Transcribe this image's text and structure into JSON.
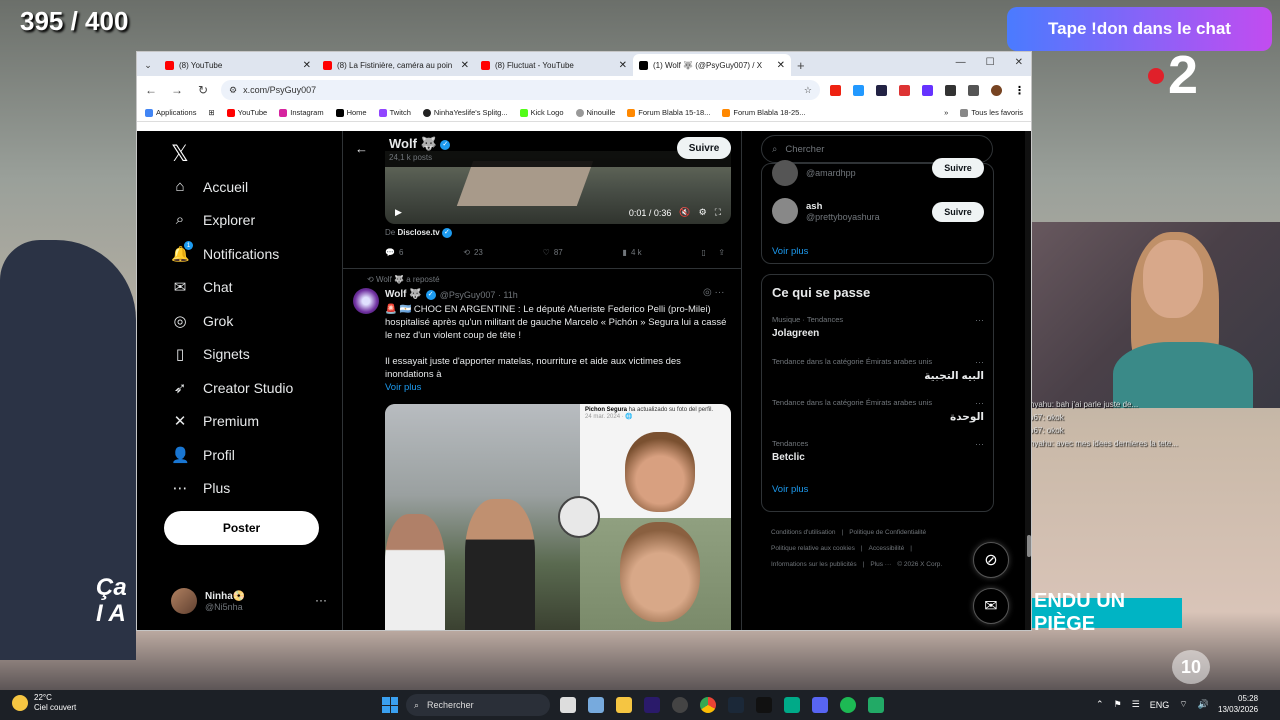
{
  "overlay": {
    "counter": "395 / 400",
    "donate": "Tape !don dans le chat",
    "channel": "2",
    "banner": "ENDU UN PIÈGE",
    "ten": "10",
    "caption": "Ça\nI A",
    "chat": [
      "Netanyahu: bah j'ai parle juste de...",
      "Kaido67: okok",
      "Kaido67: okok",
      "Netanyahu: avec mes idees dernieres la tete..."
    ]
  },
  "browser": {
    "tabs": [
      {
        "label": "(8) YouTube",
        "icon": "youtube-icon",
        "active": false
      },
      {
        "label": "(8) La Fistinière, caméra au poin",
        "icon": "youtube-icon",
        "active": false
      },
      {
        "label": "(8) Fluctuat - YouTube",
        "icon": "youtube-icon",
        "active": false
      },
      {
        "label": "(1) Wolf 🐺 (@PsyGuy007) / X",
        "icon": "x-icon",
        "active": true
      }
    ],
    "url": "x.com/PsyGuy007",
    "bookmarks": [
      "Applications",
      "YouTube",
      "Instagram",
      "Home",
      "Twitch",
      "NinhaYeslife's Splitg...",
      "Kick Logo",
      "Ninouille",
      "Forum Blabla 15-18...",
      "Forum Blabla 18-25..."
    ],
    "bookmarks_right": "Tous les favoris",
    "window_controls": [
      "—",
      "☐",
      "✕"
    ]
  },
  "x": {
    "nav": [
      {
        "label": "Accueil",
        "icon": "home-icon",
        "glyph": "⌂"
      },
      {
        "label": "Explorer",
        "icon": "search-icon",
        "glyph": "⌕"
      },
      {
        "label": "Notifications",
        "icon": "bell-icon",
        "glyph": "🔔"
      },
      {
        "label": "Chat",
        "icon": "mail-icon",
        "glyph": "✉"
      },
      {
        "label": "Grok",
        "icon": "grok-icon",
        "glyph": "◎"
      },
      {
        "label": "Signets",
        "icon": "bookmark-icon",
        "glyph": "▯"
      },
      {
        "label": "Creator Studio",
        "icon": "rocket-icon",
        "glyph": "➶"
      },
      {
        "label": "Premium",
        "icon": "x-logo-icon",
        "glyph": "✕"
      },
      {
        "label": "Profil",
        "icon": "person-icon",
        "glyph": "👤"
      },
      {
        "label": "Plus",
        "icon": "more-icon",
        "glyph": "⋯"
      }
    ],
    "notif_count": "1",
    "post_button": "Poster",
    "account": {
      "name": "Ninha📀",
      "handle": "@Ni5nha"
    },
    "profile": {
      "name": "Wolf 🐺",
      "posts": "24,1 k posts",
      "follow": "Suivre"
    },
    "video": {
      "time": "0:01 / 0:36"
    },
    "from": {
      "prefix": "De",
      "source": "Disclose.tv"
    },
    "tweet1_actions": {
      "replies": "6",
      "reposts": "23",
      "likes": "87",
      "views": "4 k"
    },
    "tweet2": {
      "reposted": "Wolf 🐺 a reposté",
      "name": "Wolf 🐺",
      "handle": "@PsyGuy007 · 11h",
      "text1": "🚨 🇦🇷 CHOC EN ARGENTINE : Le député Afueriste Federico Pelli (pro-Milei) hospitalisé après qu'un militant de gauche Marcelo « Pichón » Segura lui a cassé le nez d'un violent coup de tête !",
      "text2": "Il essayait juste d'apporter matelas, nourriture et aide aux victimes des inondations à",
      "more": "Voir plus",
      "img_caption_name": "Pichon Segura",
      "img_caption_rest": " ha actualizado su foto del perfil.",
      "img_date": "24 mar. 2024 · 🌐"
    },
    "search_placeholder": "Chercher",
    "suggestions": [
      {
        "name": "",
        "handle": "@amardhpp",
        "follow": "Suivre"
      },
      {
        "name": "ash",
        "handle": "@prettyboyashura",
        "follow": "Suivre"
      }
    ],
    "see_more": "Voir plus",
    "trends_title": "Ce qui se passe",
    "trends": [
      {
        "cat": "Musique · Tendances",
        "name": "Jolagreen",
        "rtl": false
      },
      {
        "cat": "Tendance dans la catégorie Émirats arabes unis",
        "name": "البيه التجبية",
        "rtl": true
      },
      {
        "cat": "Tendance dans la catégorie Émirats arabes unis",
        "name": "الوحدة",
        "rtl": true
      },
      {
        "cat": "Tendances",
        "name": "Betclic",
        "rtl": false
      }
    ],
    "trends_more": "Voir plus",
    "footer": [
      "Conditions d'utilisation",
      "|",
      "Politique de Confidentialité",
      "|",
      "Politique relative aux cookies",
      "|",
      "Accessibilité",
      "|",
      "Informations sur les publicités",
      "|",
      "Plus ···",
      "© 2026 X Corp."
    ]
  },
  "taskbar": {
    "temp": "22°C",
    "weather": "Ciel couvert",
    "search": "Rechercher",
    "lang": "ENG",
    "time": "05:28",
    "date": "13/03/2026"
  }
}
